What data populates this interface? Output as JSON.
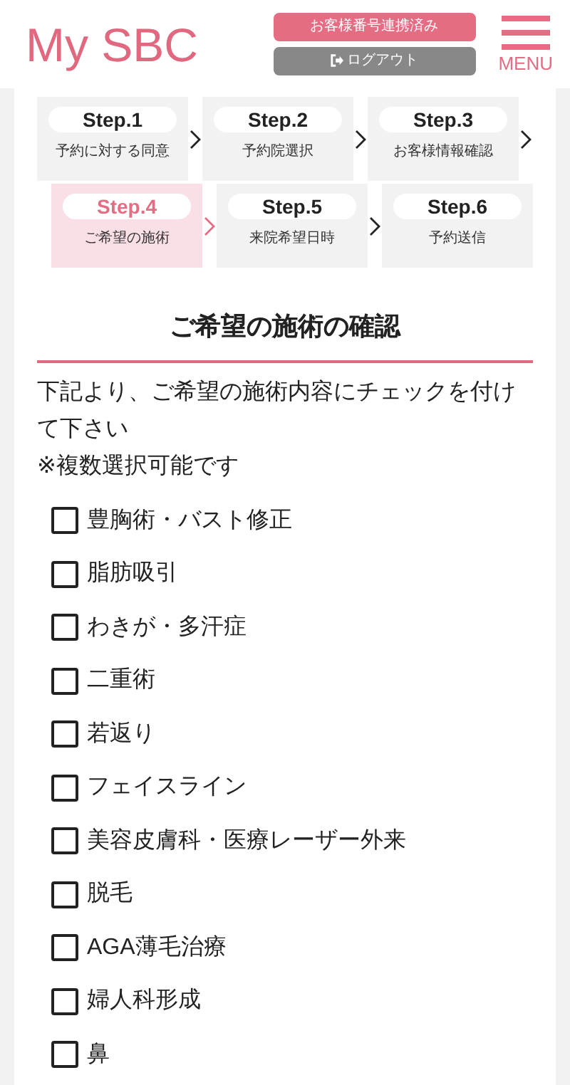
{
  "header": {
    "logo": "My SBC",
    "linked_button": "お客様番号連携済み",
    "logout_button": "ログアウト",
    "menu_label": "MENU"
  },
  "steps": [
    {
      "step": "Step.1",
      "label": "予約に対する同意",
      "selected": false
    },
    {
      "step": "Step.2",
      "label": "予約院選択",
      "selected": false
    },
    {
      "step": "Step.3",
      "label": "お客様情報確認",
      "selected": false
    },
    {
      "step": "Step.4",
      "label": "ご希望の施術",
      "selected": true
    },
    {
      "step": "Step.5",
      "label": "来院希望日時",
      "selected": false
    },
    {
      "step": "Step.6",
      "label": "予約送信",
      "selected": false
    }
  ],
  "heading": "ご希望の施術の確認",
  "instruction": "下記より、ご希望の施術内容にチェックを付けて下さい",
  "note": "※複数選択可能です",
  "treatments": [
    {
      "label": "豊胸術・バスト修正",
      "checked": false
    },
    {
      "label": "脂肪吸引",
      "checked": false
    },
    {
      "label": "わきが・多汗症",
      "checked": false
    },
    {
      "label": "二重術",
      "checked": false
    },
    {
      "label": "若返り",
      "checked": false
    },
    {
      "label": "フェイスライン",
      "checked": false
    },
    {
      "label": "美容皮膚科・医療レーザー外来",
      "checked": false
    },
    {
      "label": "脱毛",
      "checked": false
    },
    {
      "label": "AGA薄毛治療",
      "checked": false
    },
    {
      "label": "婦人科形成",
      "checked": false
    },
    {
      "label": "鼻",
      "checked": false
    }
  ]
}
